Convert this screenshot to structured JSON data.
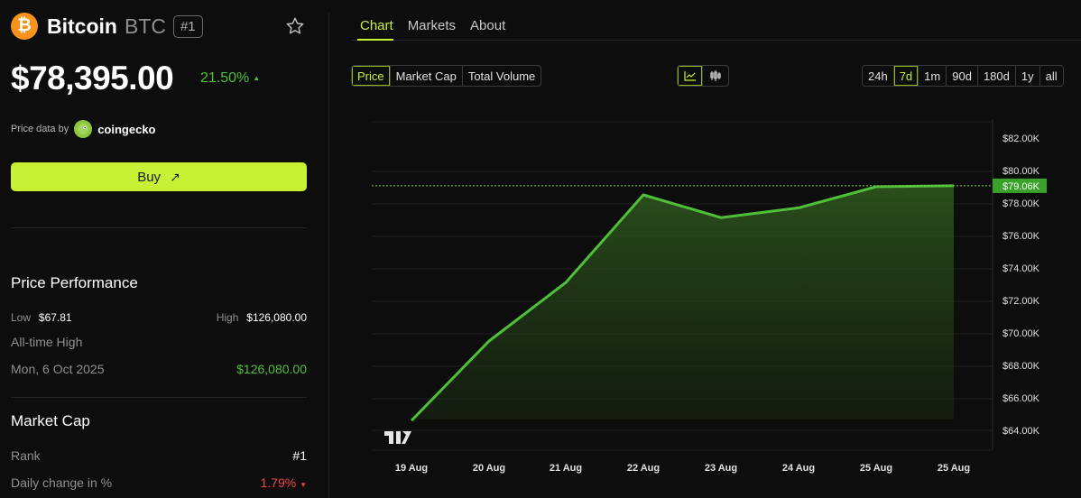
{
  "coin": {
    "logo_glyph": "₿",
    "name": "Bitcoin",
    "symbol": "BTC",
    "rank_badge": "#1",
    "price": "$78,395.00",
    "change": "21.50%",
    "change_arrow": "▲",
    "price_data_label": "Price data by",
    "provider": "coingecko"
  },
  "buy": {
    "label": "Buy",
    "icon": "↗"
  },
  "performance": {
    "title": "Price Performance",
    "low_label": "Low",
    "low_value": "$67.81",
    "high_label": "High",
    "high_value": "$126,080.00",
    "ath_label": "All-time High",
    "ath_date": "Mon, 6 Oct 2025",
    "ath_value": "$126,080.00"
  },
  "market_cap": {
    "title": "Market Cap",
    "rank_label": "Rank",
    "rank_value": "#1",
    "daily_label": "Daily change in %",
    "daily_value": "1.79%",
    "daily_arrow": "▼"
  },
  "tabs": [
    "Chart",
    "Markets",
    "About"
  ],
  "active_tab": "Chart",
  "metrics": [
    "Price",
    "Market Cap",
    "Total Volume"
  ],
  "active_metric": "Price",
  "chart_types": [
    "line-chart-icon",
    "candlestick-icon"
  ],
  "active_chart_type": "line-chart-icon",
  "ranges": [
    "24h",
    "7d",
    "1m",
    "90d",
    "180d",
    "1y",
    "all"
  ],
  "active_range": "7d",
  "colors": {
    "accent": "#c6f135",
    "up": "#4fbf3a",
    "down": "#ef4444",
    "btc": "#f7931a",
    "line": "#4fbf3a"
  },
  "chart_data": {
    "type": "area",
    "categories": [
      "19 Aug",
      "20 Aug",
      "21 Aug",
      "22 Aug",
      "23 Aug",
      "24 Aug",
      "25 Aug",
      "25 Aug"
    ],
    "values": [
      64600,
      69500,
      73100,
      78500,
      77100,
      77700,
      79000,
      79060
    ],
    "y_ticks": [
      "$82.00K",
      "$80.00K",
      "$78.00K",
      "$76.00K",
      "$74.00K",
      "$72.00K",
      "$70.00K",
      "$68.00K",
      "$66.00K",
      "$64.00K"
    ],
    "y_tick_values": [
      82000,
      80000,
      78000,
      76000,
      74000,
      72000,
      70000,
      68000,
      66000,
      64000
    ],
    "ylim": [
      64000,
      82000
    ],
    "current_label": "$79.06K",
    "current_value": 79060,
    "grid": true,
    "watermark": "TV"
  }
}
